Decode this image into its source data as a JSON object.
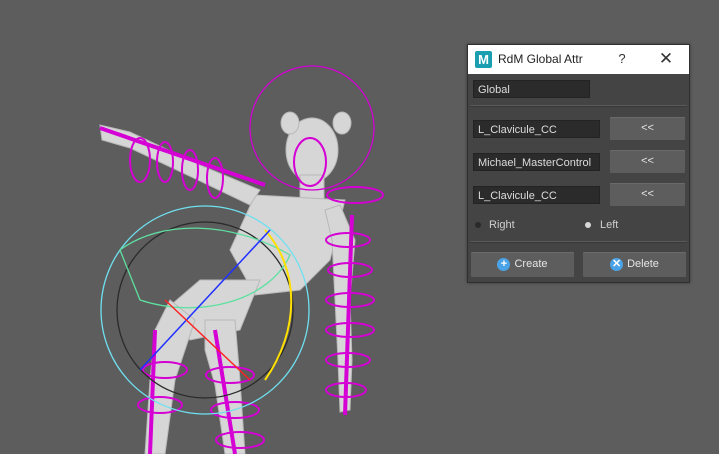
{
  "dialog": {
    "title": "RdM Global Attr",
    "app_icon_letter": "M",
    "help_label": "?",
    "close_label": "✕",
    "global_field": "Global",
    "rows": [
      {
        "value": "L_Clavicule_CC",
        "button": "<<"
      },
      {
        "value": "Michael_MasterControl",
        "button": "<<"
      },
      {
        "value": "L_Clavicule_CC",
        "button": "<<"
      }
    ],
    "radio": {
      "right_label": "Right",
      "left_label": "Left",
      "selected": "Left"
    },
    "create_label": "Create",
    "delete_label": "Delete",
    "create_icon": "+",
    "delete_icon": "✕"
  },
  "colors": {
    "viewport_bg": "#5d5d5d",
    "rig_controls": "#d400d4",
    "cyan_control": "#6fe0f0",
    "green_control": "#5de0a0",
    "yellow_control": "#ffe000",
    "mesh": "#d9d9d9",
    "icon_blue": "#1b9fb0"
  }
}
